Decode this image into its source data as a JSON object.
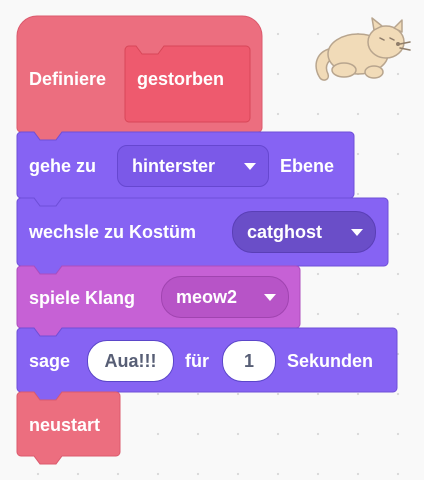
{
  "blocks": {
    "define": {
      "label": "Definiere",
      "name": "gestorben",
      "color": "#ec6e7f"
    },
    "goto_layer": {
      "prefix": "gehe zu",
      "option": "hinterster",
      "suffix": "Ebene",
      "color": "#8663f3"
    },
    "switch_costume": {
      "label": "wechsle zu Kostüm",
      "option": "catghost",
      "color": "#8663f3"
    },
    "play_sound": {
      "label": "spiele Klang",
      "option": "meow2",
      "color": "#c661d5"
    },
    "say_for": {
      "label": "sage",
      "message": "Aua!!!",
      "mid": "für",
      "seconds": "1",
      "suffix": "Sekunden",
      "color": "#8663f3"
    },
    "call": {
      "label": "neustart",
      "color": "#ec6e7f"
    }
  },
  "sprite": {
    "icon": "cat-sprite-icon"
  }
}
